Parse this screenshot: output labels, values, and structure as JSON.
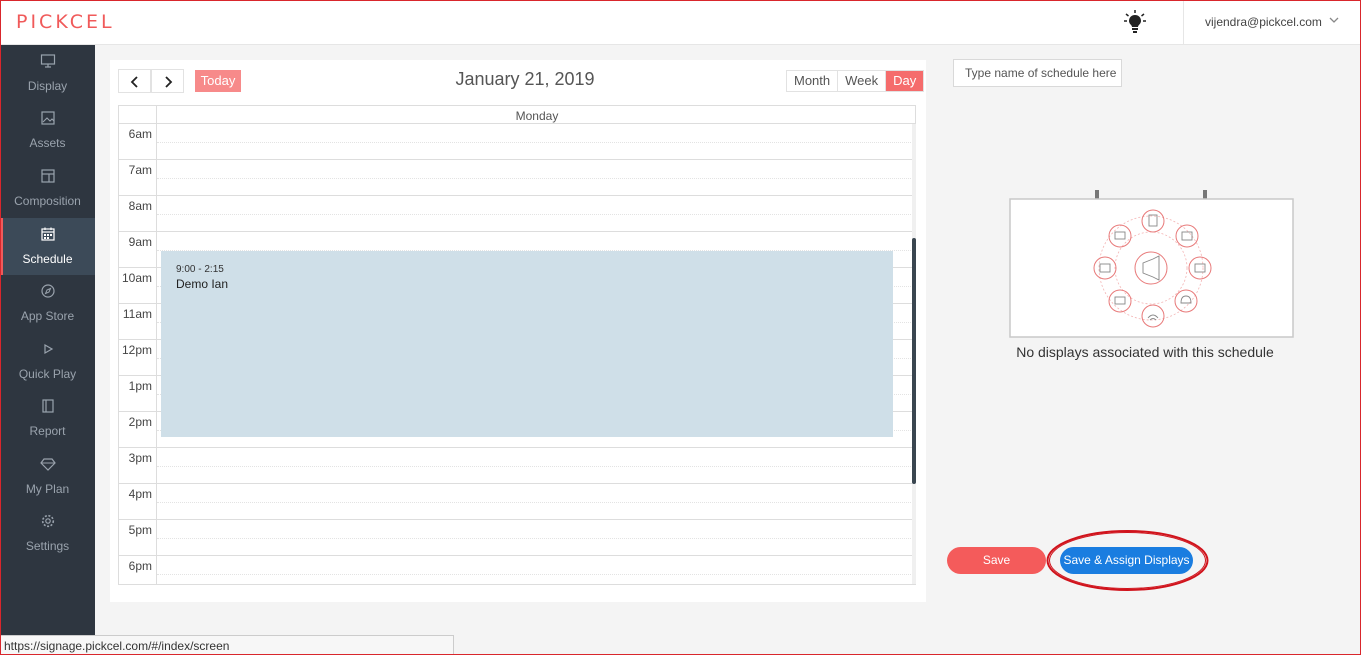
{
  "header": {
    "logo": "PICKCEL",
    "user_email": "vijendra@pickcel.com"
  },
  "sidebar": {
    "items": [
      {
        "label": "Display",
        "icon": "monitor-icon"
      },
      {
        "label": "Assets",
        "icon": "image-icon"
      },
      {
        "label": "Composition",
        "icon": "layout-icon"
      },
      {
        "label": "Schedule",
        "icon": "calendar-icon",
        "active": true
      },
      {
        "label": "App Store",
        "icon": "compass-icon"
      },
      {
        "label": "Quick Play",
        "icon": "play-icon"
      },
      {
        "label": "Report",
        "icon": "book-icon"
      },
      {
        "label": "My Plan",
        "icon": "diamond-icon"
      },
      {
        "label": "Settings",
        "icon": "gear-icon"
      }
    ]
  },
  "calendar": {
    "today_label": "Today",
    "title": "January 21, 2019",
    "views": [
      "Month",
      "Week",
      "Day"
    ],
    "active_view": "Day",
    "day_header": "Monday",
    "hours": [
      "6am",
      "7am",
      "8am",
      "9am",
      "10am",
      "11am",
      "12pm",
      "1pm",
      "2pm",
      "3pm",
      "4pm",
      "5pm",
      "6pm"
    ],
    "event": {
      "time": "9:00 - 2:15",
      "title": "Demo Ian"
    }
  },
  "schedule": {
    "name_placeholder": "Type name of schedule here",
    "empty_message": "No displays associated with this schedule"
  },
  "actions": {
    "save_label": "Save",
    "assign_label": "Save & Assign Displays"
  },
  "statusbar": {
    "url": "https://signage.pickcel.com/#/index/screen"
  },
  "colors": {
    "brand": "#f05a5a",
    "sidebar_bg": "#2e3640",
    "event_bg": "#cfdfe8",
    "primary_button": "#1a7de0",
    "highlight_ring": "#d0121b"
  }
}
